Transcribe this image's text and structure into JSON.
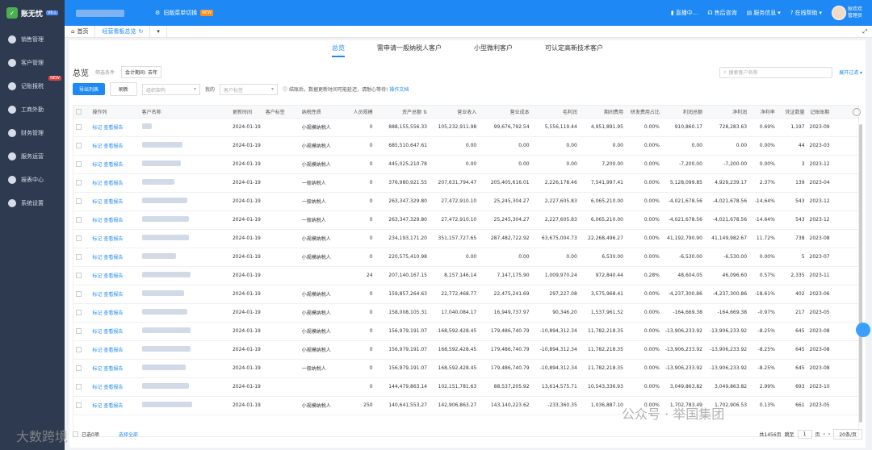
{
  "app": {
    "name": "账无忧",
    "version": "V6.L",
    "switch_label": "旧版菜单切换",
    "switch_badge": "NEW"
  },
  "topnav": [
    {
      "label": "直播中..."
    },
    {
      "label": "售后咨询"
    },
    {
      "label": "服务信息"
    },
    {
      "label": "在线帮助"
    }
  ],
  "user": {
    "name": "秋欢欢",
    "role": "管理员"
  },
  "sidebar": [
    {
      "label": "销售管理",
      "badge": ""
    },
    {
      "label": "客户管理",
      "badge": ""
    },
    {
      "label": "记账报税",
      "badge": "NEW"
    },
    {
      "label": "工商外勤",
      "badge": ""
    },
    {
      "label": "财务管理",
      "badge": ""
    },
    {
      "label": "服务运营",
      "badge": ""
    },
    {
      "label": "报表中心",
      "badge": ""
    },
    {
      "label": "系统设置",
      "badge": ""
    }
  ],
  "tabs": [
    {
      "label": "首页"
    },
    {
      "label": "经营看板总览"
    }
  ],
  "category_tabs": [
    "总览",
    "需申请一般纳税人客户",
    "小型微利客户",
    "可认定高新技术客户"
  ],
  "filter": {
    "title": "总览",
    "label": "筛选条件",
    "chip": "会计期间: 去年",
    "search_placeholder": "搜索客户名称",
    "expand": "展开过滤"
  },
  "actions": {
    "export": "导出列表",
    "refresh": "刷新",
    "org_placeholder": "组织架构",
    "mine": "我的",
    "tag_placeholder": "客户标签",
    "hint": "结账后，数据更新时间可能延迟，请耐心等待!",
    "hint_link": "操作文档"
  },
  "columns": [
    "操作列",
    "客户名称",
    "更新时间",
    "客户标签",
    "纳税性质",
    "人员规模",
    "资产总额",
    "营业收入",
    "营业成本",
    "毛利润",
    "期间费用",
    "研发费用占比",
    "利润总额",
    "净利润",
    "净利率",
    "凭证数量",
    "记账账期"
  ],
  "row_ops": {
    "mark": "标记",
    "view": "查看报告"
  },
  "rows": [
    [
      "2024-01-19",
      "",
      "小规模纳税人",
      "0",
      "888,155,556.33",
      "105,232,911.98",
      "99,676,792.54",
      "5,556,119.44",
      "4,951,891.95",
      "0.00%",
      "910,860.17",
      "728,283.63",
      "0.69%",
      "1,197",
      "2023-09"
    ],
    [
      "2024-01-19",
      "",
      "小规模纳税人",
      "0",
      "685,510,647.61",
      "0.00",
      "0.00",
      "0.00",
      "0.00",
      "0.00%",
      "0.00",
      "0.00",
      "0.00%",
      "44",
      "2023-03"
    ],
    [
      "2024-01-19",
      "",
      "小规模纳税人",
      "0",
      "445,025,210.78",
      "0.00",
      "0.00",
      "0.00",
      "7,200.00",
      "0.00%",
      "-7,200.00",
      "-7,200.00",
      "0.00%",
      "3",
      "2023-12"
    ],
    [
      "2024-01-19",
      "",
      "一般纳税人",
      "0",
      "376,980,921.55",
      "207,631,794.47",
      "205,405,616.01",
      "2,226,178.46",
      "7,541,997.41",
      "0.00%",
      "5,128,099.85",
      "4,929,239.17",
      "2.37%",
      "139",
      "2023-04"
    ],
    [
      "2024-01-19",
      "",
      "一般纳税人",
      "0",
      "263,347,329.80",
      "27,472,910.10",
      "25,245,304.27",
      "2,227,605.83",
      "6,065,210.00",
      "0.00%",
      "-4,021,678.56",
      "-4,021,678.56",
      "-14.64%",
      "543",
      "2023-12"
    ],
    [
      "2024-01-19",
      "",
      "一般纳税人",
      "0",
      "263,347,329.80",
      "27,472,910.10",
      "25,245,304.27",
      "2,227,605.83",
      "6,065,210.00",
      "0.00%",
      "-4,021,678.56",
      "-4,021,678.56",
      "-14.64%",
      "543",
      "2023-12"
    ],
    [
      "2024-01-19",
      "",
      "小规模纳税人",
      "0",
      "234,193,171.20",
      "351,157,727.65",
      "287,482,722.92",
      "63,675,004.73",
      "22,268,496.27",
      "0.00%",
      "41,192,790.90",
      "41,149,982.67",
      "11.72%",
      "738",
      "2023-08"
    ],
    [
      "2024-01-19",
      "",
      "小规模纳税人",
      "0",
      "220,575,410.98",
      "0.00",
      "0.00",
      "0.00",
      "6,530.00",
      "0.00%",
      "-6,530.00",
      "-6,530.00",
      "0.00%",
      "5",
      "2023-07"
    ],
    [
      "2024-01-19",
      "",
      "",
      "24",
      "207,140,167.15",
      "8,157,146.14",
      "7,147,175.90",
      "1,009,970.24",
      "972,840.44",
      "0.28%",
      "48,604.05",
      "46,096.60",
      "0.57%",
      "2,335",
      "2023-11"
    ],
    [
      "2024-01-19",
      "",
      "小规模纳税人",
      "0",
      "159,857,264.63",
      "22,772,468.77",
      "22,475,241.69",
      "297,227.08",
      "3,575,968.41",
      "0.00%",
      "-4,237,300.86",
      "-4,237,300.86",
      "-18.61%",
      "402",
      "2023-06"
    ],
    [
      "2024-01-19",
      "",
      "小规模纳税人",
      "0",
      "158,008,105.31",
      "17,040,084.17",
      "16,949,737.97",
      "90,346.20",
      "1,537,961.52",
      "0.00%",
      "-164,669.38",
      "-164,669.38",
      "-0.97%",
      "217",
      "2023-05"
    ],
    [
      "2024-01-19",
      "",
      "小规模纳税人",
      "0",
      "156,979,191.07",
      "168,592,428.45",
      "179,486,740.79",
      "-10,894,312.34",
      "11,782,218.35",
      "0.00%",
      "-13,906,233.92",
      "-13,906,233.92",
      "-8.25%",
      "645",
      "2023-08"
    ],
    [
      "2024-01-19",
      "",
      "小规模纳税人",
      "0",
      "156,979,191.07",
      "168,592,428.45",
      "179,486,740.79",
      "-10,894,312.34",
      "11,782,218.35",
      "0.00%",
      "-13,906,233.92",
      "-13,906,233.92",
      "-8.25%",
      "645",
      "2023-08"
    ],
    [
      "2024-01-19",
      "",
      "一般纳税人",
      "0",
      "156,979,191.07",
      "168,592,428.45",
      "179,486,740.79",
      "-10,894,312.34",
      "11,782,218.35",
      "0.00%",
      "-13,906,233.92",
      "-13,906,233.92",
      "-8.25%",
      "645",
      "2023-08"
    ],
    [
      "2024-01-19",
      "",
      "",
      "0",
      "144,479,863.14",
      "102,151,781.63",
      "88,537,205.92",
      "13,614,575.71",
      "10,543,336.93",
      "0.00%",
      "3,049,863.82",
      "3,049,863.82",
      "2.99%",
      "693",
      "2023-10"
    ],
    [
      "2024-01-19",
      "",
      "小规模纳税人",
      "250",
      "140,641,553.27",
      "142,906,863.27",
      "143,140,223.62",
      "-233,360.35",
      "1,036,887.10",
      "0.00%",
      "1,702,783.49",
      "1,702,906.53",
      "0.13%",
      "661",
      "2023-05"
    ]
  ],
  "footer": {
    "selected": "已选0项",
    "select_all": "选择全部",
    "total": "共1456页",
    "goto": "跳至",
    "page": "1",
    "page_unit": "页",
    "page_size": "20条/页"
  },
  "watermarks": {
    "left": "大数跨境",
    "right": "公众号 · 举国集团"
  }
}
